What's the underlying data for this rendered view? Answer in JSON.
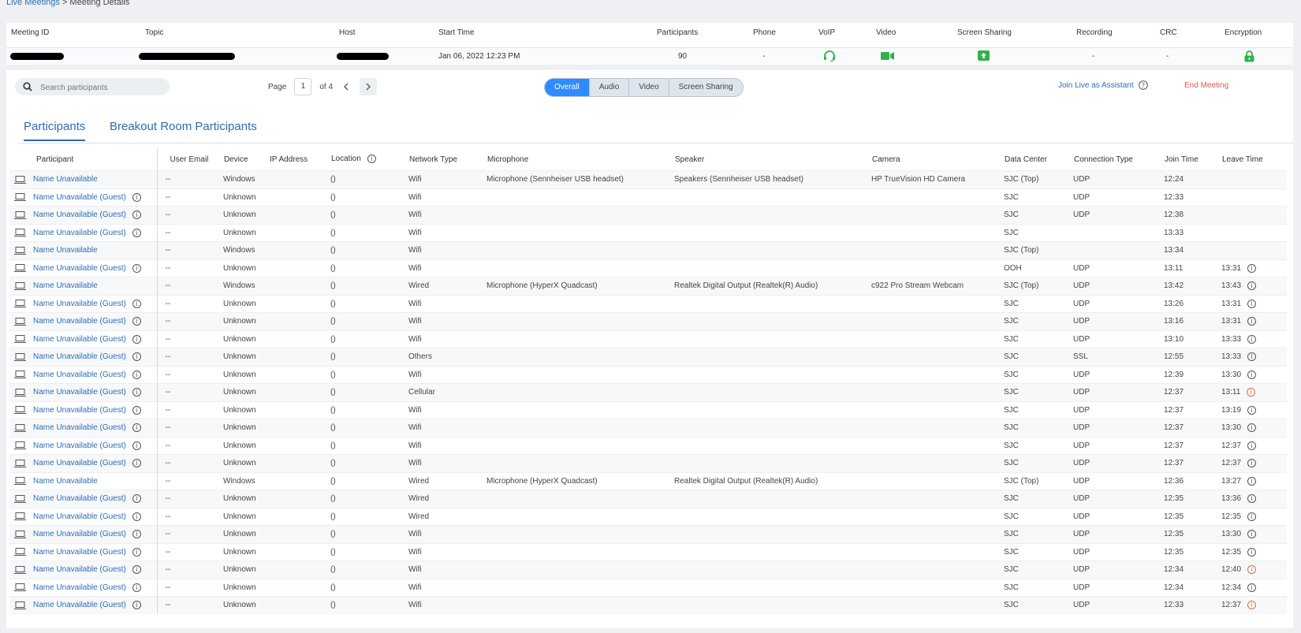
{
  "breadcrumb": {
    "parent": "Live Meetings",
    "separator": " > ",
    "current": "Meeting Details"
  },
  "summary": {
    "headers": {
      "meeting_id": "Meeting ID",
      "topic": "Topic",
      "host": "Host",
      "start_time": "Start Time",
      "participants": "Participants",
      "phone": "Phone",
      "voip": "VoIP",
      "video": "Video",
      "screen_sharing": "Screen Sharing",
      "recording": "Recording",
      "crc": "CRC",
      "encryption": "Encryption"
    },
    "values": {
      "start_time": "Jan 06, 2022 12:23 PM",
      "participants": "90",
      "phone": "-",
      "recording": "-",
      "crc": "-"
    },
    "icons": {
      "voip": "headset-icon",
      "video": "video-camera-icon",
      "screen_sharing": "screen-share-icon",
      "encryption": "lock-icon"
    },
    "accent_green": "#32b14a"
  },
  "toolbar": {
    "search_placeholder": "Search participants",
    "page_label": "Page",
    "page_value": "1",
    "page_of": "of 4",
    "filters": [
      "Overall",
      "Audio",
      "Video",
      "Screen Sharing"
    ],
    "active_filter": "Overall",
    "join_live": "Join Live as Assistant",
    "end_meeting": "End Meeting"
  },
  "tabs": [
    "Participants",
    "Breakout Room Participants"
  ],
  "table": {
    "columns": [
      "Participant",
      "User Email",
      "Device",
      "IP Address",
      "Location",
      "Network Type",
      "Microphone",
      "Speaker",
      "Camera",
      "Data Center",
      "Connection Type",
      "Join Time",
      "Leave Time"
    ],
    "rows": [
      {
        "name": "Name Unavailable",
        "guest_info": false,
        "email": "--",
        "device": "Windows",
        "ip": "",
        "location": "()",
        "network": "Wifi",
        "mic": "Microphone (Sennheiser USB headset)",
        "speaker": "Speakers (Sennheiser USB headset)",
        "camera": "HP TrueVision HD Camera",
        "dc": "SJC (Top)",
        "conn": "UDP",
        "join": "12:24",
        "leave": "",
        "leave_icon": ""
      },
      {
        "name": "Name Unavailable (Guest)",
        "guest_info": true,
        "email": "--",
        "device": "Unknown",
        "ip": "",
        "location": "()",
        "network": "Wifi",
        "mic": "",
        "speaker": "",
        "camera": "",
        "dc": "SJC",
        "conn": "UDP",
        "join": "12:33",
        "leave": "",
        "leave_icon": ""
      },
      {
        "name": "Name Unavailable (Guest)",
        "guest_info": true,
        "email": "--",
        "device": "Unknown",
        "ip": "",
        "location": "()",
        "network": "Wifi",
        "mic": "",
        "speaker": "",
        "camera": "",
        "dc": "SJC",
        "conn": "UDP",
        "join": "12:38",
        "leave": "",
        "leave_icon": ""
      },
      {
        "name": "Name Unavailable (Guest)",
        "guest_info": true,
        "email": "--",
        "device": "Unknown",
        "ip": "",
        "location": "()",
        "network": "Wifi",
        "mic": "",
        "speaker": "",
        "camera": "",
        "dc": "SJC",
        "conn": "",
        "join": "13:33",
        "leave": "",
        "leave_icon": ""
      },
      {
        "name": "Name Unavailable",
        "guest_info": false,
        "email": "--",
        "device": "Windows",
        "ip": "",
        "location": "()",
        "network": "Wifi",
        "mic": "",
        "speaker": "",
        "camera": "",
        "dc": "SJC (Top)",
        "conn": "",
        "join": "13:34",
        "leave": "",
        "leave_icon": ""
      },
      {
        "name": "Name Unavailable (Guest)",
        "guest_info": true,
        "email": "--",
        "device": "Unknown",
        "ip": "",
        "location": "()",
        "network": "Wifi",
        "mic": "",
        "speaker": "",
        "camera": "",
        "dc": "OOH",
        "conn": "UDP",
        "join": "13:11",
        "leave": "13:31",
        "leave_icon": "info"
      },
      {
        "name": "Name Unavailable",
        "guest_info": false,
        "email": "--",
        "device": "Windows",
        "ip": "",
        "location": "()",
        "network": "Wired",
        "mic": "Microphone (HyperX Quadcast)",
        "speaker": "Realtek Digital Output (Realtek(R) Audio)",
        "camera": "c922 Pro Stream Webcam",
        "dc": "SJC (Top)",
        "conn": "UDP",
        "join": "13:42",
        "leave": "13:43",
        "leave_icon": "info"
      },
      {
        "name": "Name Unavailable (Guest)",
        "guest_info": true,
        "email": "--",
        "device": "Unknown",
        "ip": "",
        "location": "()",
        "network": "Wifi",
        "mic": "",
        "speaker": "",
        "camera": "",
        "dc": "SJC",
        "conn": "UDP",
        "join": "13:26",
        "leave": "13:31",
        "leave_icon": "info"
      },
      {
        "name": "Name Unavailable (Guest)",
        "guest_info": true,
        "email": "--",
        "device": "Unknown",
        "ip": "",
        "location": "()",
        "network": "Wifi",
        "mic": "",
        "speaker": "",
        "camera": "",
        "dc": "SJC",
        "conn": "UDP",
        "join": "13:16",
        "leave": "13:31",
        "leave_icon": "info"
      },
      {
        "name": "Name Unavailable (Guest)",
        "guest_info": true,
        "email": "--",
        "device": "Unknown",
        "ip": "",
        "location": "()",
        "network": "Wifi",
        "mic": "",
        "speaker": "",
        "camera": "",
        "dc": "SJC",
        "conn": "UDP",
        "join": "13:10",
        "leave": "13:33",
        "leave_icon": "info"
      },
      {
        "name": "Name Unavailable (Guest)",
        "guest_info": true,
        "email": "--",
        "device": "Unknown",
        "ip": "",
        "location": "()",
        "network": "Others",
        "mic": "",
        "speaker": "",
        "camera": "",
        "dc": "SJC",
        "conn": "SSL",
        "join": "12:55",
        "leave": "13:33",
        "leave_icon": "info"
      },
      {
        "name": "Name Unavailable (Guest)",
        "guest_info": true,
        "email": "--",
        "device": "Unknown",
        "ip": "",
        "location": "()",
        "network": "Wifi",
        "mic": "",
        "speaker": "",
        "camera": "",
        "dc": "SJC",
        "conn": "UDP",
        "join": "12:39",
        "leave": "13:30",
        "leave_icon": "info"
      },
      {
        "name": "Name Unavailable (Guest)",
        "guest_info": true,
        "email": "--",
        "device": "Unknown",
        "ip": "",
        "location": "()",
        "network": "Cellular",
        "mic": "",
        "speaker": "",
        "camera": "",
        "dc": "SJC",
        "conn": "UDP",
        "join": "12:37",
        "leave": "13:11",
        "leave_icon": "warning"
      },
      {
        "name": "Name Unavailable (Guest)",
        "guest_info": true,
        "email": "--",
        "device": "Unknown",
        "ip": "",
        "location": "()",
        "network": "Wifi",
        "mic": "",
        "speaker": "",
        "camera": "",
        "dc": "SJC",
        "conn": "UDP",
        "join": "12:37",
        "leave": "13:19",
        "leave_icon": "info"
      },
      {
        "name": "Name Unavailable (Guest)",
        "guest_info": true,
        "email": "--",
        "device": "Unknown",
        "ip": "",
        "location": "()",
        "network": "Wifi",
        "mic": "",
        "speaker": "",
        "camera": "",
        "dc": "SJC",
        "conn": "UDP",
        "join": "12:37",
        "leave": "13:30",
        "leave_icon": "info"
      },
      {
        "name": "Name Unavailable (Guest)",
        "guest_info": true,
        "email": "--",
        "device": "Unknown",
        "ip": "",
        "location": "()",
        "network": "Wifi",
        "mic": "",
        "speaker": "",
        "camera": "",
        "dc": "SJC",
        "conn": "UDP",
        "join": "12:37",
        "leave": "12:37",
        "leave_icon": "info"
      },
      {
        "name": "Name Unavailable (Guest)",
        "guest_info": true,
        "email": "--",
        "device": "Unknown",
        "ip": "",
        "location": "()",
        "network": "Wifi",
        "mic": "",
        "speaker": "",
        "camera": "",
        "dc": "SJC",
        "conn": "UDP",
        "join": "12:37",
        "leave": "12:37",
        "leave_icon": "info"
      },
      {
        "name": "Name Unavailable",
        "guest_info": false,
        "email": "--",
        "device": "Windows",
        "ip": "",
        "location": "()",
        "network": "Wired",
        "mic": "Microphone (HyperX Quadcast)",
        "speaker": "Realtek Digital Output (Realtek(R) Audio)",
        "camera": "",
        "dc": "SJC (Top)",
        "conn": "UDP",
        "join": "12:36",
        "leave": "13:27",
        "leave_icon": "info"
      },
      {
        "name": "Name Unavailable (Guest)",
        "guest_info": true,
        "email": "--",
        "device": "Unknown",
        "ip": "",
        "location": "()",
        "network": "Wired",
        "mic": "",
        "speaker": "",
        "camera": "",
        "dc": "SJC",
        "conn": "UDP",
        "join": "12:35",
        "leave": "13:36",
        "leave_icon": "info"
      },
      {
        "name": "Name Unavailable (Guest)",
        "guest_info": true,
        "email": "--",
        "device": "Unknown",
        "ip": "",
        "location": "()",
        "network": "Wired",
        "mic": "",
        "speaker": "",
        "camera": "",
        "dc": "SJC",
        "conn": "UDP",
        "join": "12:35",
        "leave": "12:35",
        "leave_icon": "info"
      },
      {
        "name": "Name Unavailable (Guest)",
        "guest_info": true,
        "email": "--",
        "device": "Unknown",
        "ip": "",
        "location": "()",
        "network": "Wifi",
        "mic": "",
        "speaker": "",
        "camera": "",
        "dc": "SJC",
        "conn": "UDP",
        "join": "12:35",
        "leave": "13:30",
        "leave_icon": "info"
      },
      {
        "name": "Name Unavailable (Guest)",
        "guest_info": true,
        "email": "--",
        "device": "Unknown",
        "ip": "",
        "location": "()",
        "network": "Wifi",
        "mic": "",
        "speaker": "",
        "camera": "",
        "dc": "SJC",
        "conn": "UDP",
        "join": "12:35",
        "leave": "12:35",
        "leave_icon": "info"
      },
      {
        "name": "Name Unavailable (Guest)",
        "guest_info": true,
        "email": "--",
        "device": "Unknown",
        "ip": "",
        "location": "()",
        "network": "Wifi",
        "mic": "",
        "speaker": "",
        "camera": "",
        "dc": "SJC",
        "conn": "UDP",
        "join": "12:34",
        "leave": "12:40",
        "leave_icon": "warning"
      },
      {
        "name": "Name Unavailable (Guest)",
        "guest_info": true,
        "email": "--",
        "device": "Unknown",
        "ip": "",
        "location": "()",
        "network": "Wifi",
        "mic": "",
        "speaker": "",
        "camera": "",
        "dc": "SJC",
        "conn": "UDP",
        "join": "12:34",
        "leave": "12:34",
        "leave_icon": "info"
      },
      {
        "name": "Name Unavailable (Guest)",
        "guest_info": true,
        "email": "--",
        "device": "Unknown",
        "ip": "",
        "location": "()",
        "network": "Wifi",
        "mic": "",
        "speaker": "",
        "camera": "",
        "dc": "SJC",
        "conn": "UDP",
        "join": "12:33",
        "leave": "12:37",
        "leave_icon": "warning"
      }
    ]
  }
}
